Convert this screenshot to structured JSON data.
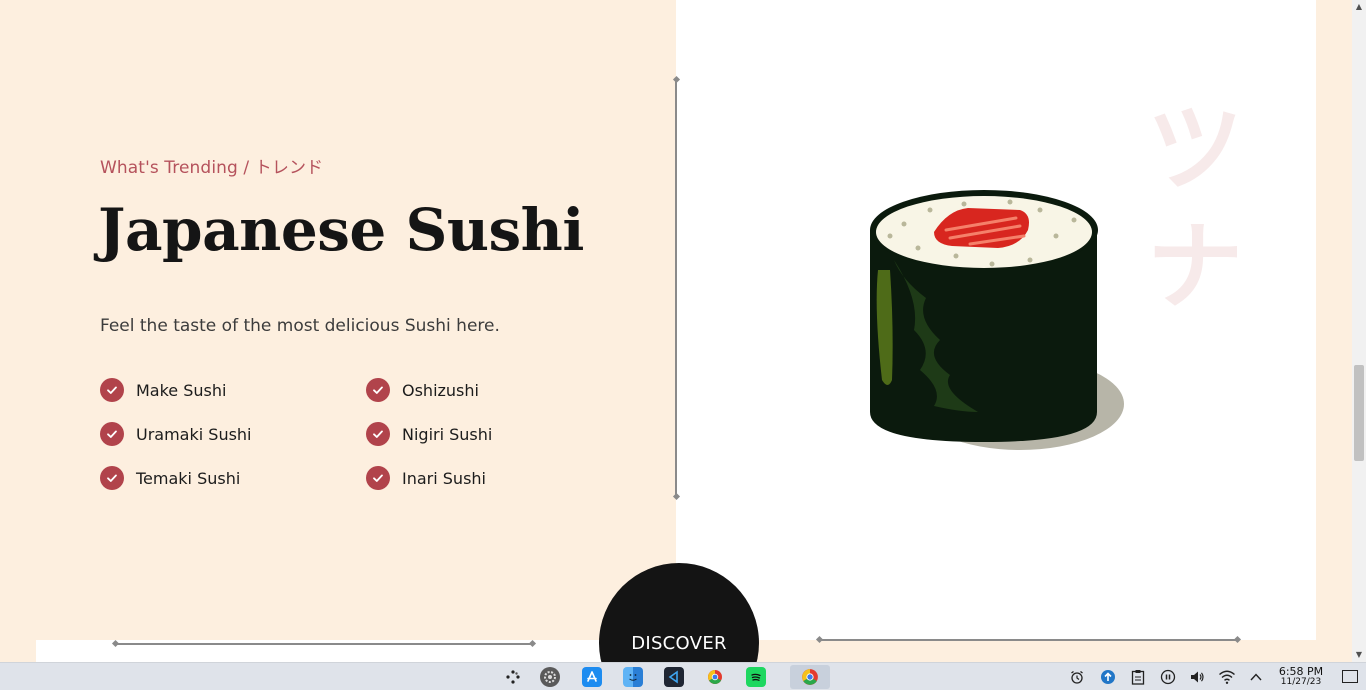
{
  "hero": {
    "eyebrow": "What's Trending / トレンド",
    "title": "Japanese Sushi",
    "subtitle": "Feel the taste of the most delicious Sushi here.",
    "features_left": [
      "Make Sushi",
      "Uramaki Sushi",
      "Temaki Sushi"
    ],
    "features_right": [
      "Oshizushi",
      "Nigiri Sushi",
      "Inari Sushi"
    ],
    "kana": "ツナ",
    "discover_label": "DISCOVER"
  },
  "taskbar": {
    "apps": [
      "pinwheel-icon",
      "system-preferences-icon",
      "app-store-icon",
      "finder-icon",
      "vscode-icon",
      "chrome-icon",
      "spotify-icon",
      "chrome-active-icon"
    ],
    "tray": [
      "alarm-icon",
      "update-icon",
      "clipboard-icon",
      "pause-icon",
      "volume-icon",
      "wifi-icon",
      "chevron-up-icon"
    ],
    "time": "6:58 PM",
    "date": "11/27/23"
  },
  "colors": {
    "cream": "#fdefdf",
    "accent": "#b1434b",
    "dark": "#141414"
  }
}
